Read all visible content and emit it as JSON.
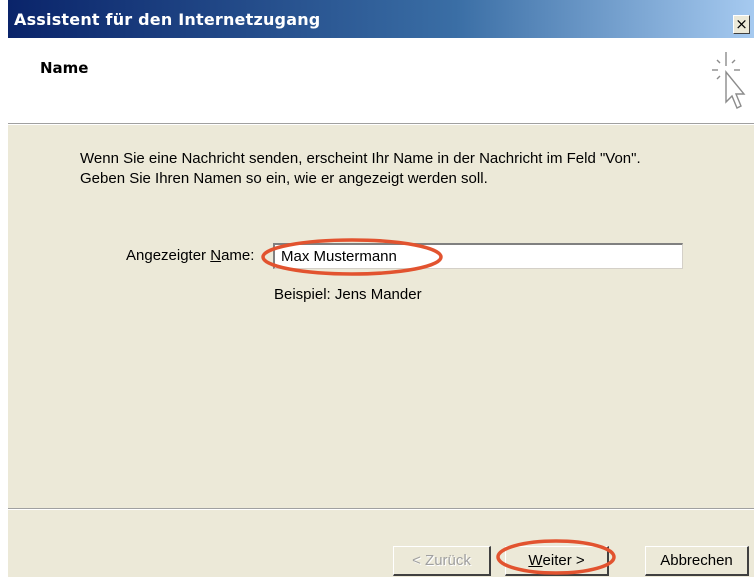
{
  "window": {
    "title": "Assistent für den Internetzugang",
    "close_glyph": "×"
  },
  "header": {
    "title": "Name",
    "icon": "wizard-cursor-sparkle-icon"
  },
  "description": {
    "line1": "Wenn Sie eine Nachricht senden, erscheint Ihr Name in der Nachricht im Feld \"Von\".",
    "line2": "Geben Sie Ihren Namen so ein, wie er angezeigt werden soll."
  },
  "form": {
    "label_prefix": "Angezeigter ",
    "label_accel": "N",
    "label_suffix": "ame:",
    "name_value": "Max Mustermann",
    "example": "Beispiel: Jens Mander"
  },
  "buttons": {
    "back": "< Zurück",
    "next_accel": "W",
    "next_rest": "eiter >",
    "cancel": "Abbrechen"
  },
  "colors": {
    "titlebar_start": "#0a246a",
    "titlebar_end": "#a6caf0",
    "dialog_bg": "#ece9d8",
    "annotation": "#e2532f"
  }
}
